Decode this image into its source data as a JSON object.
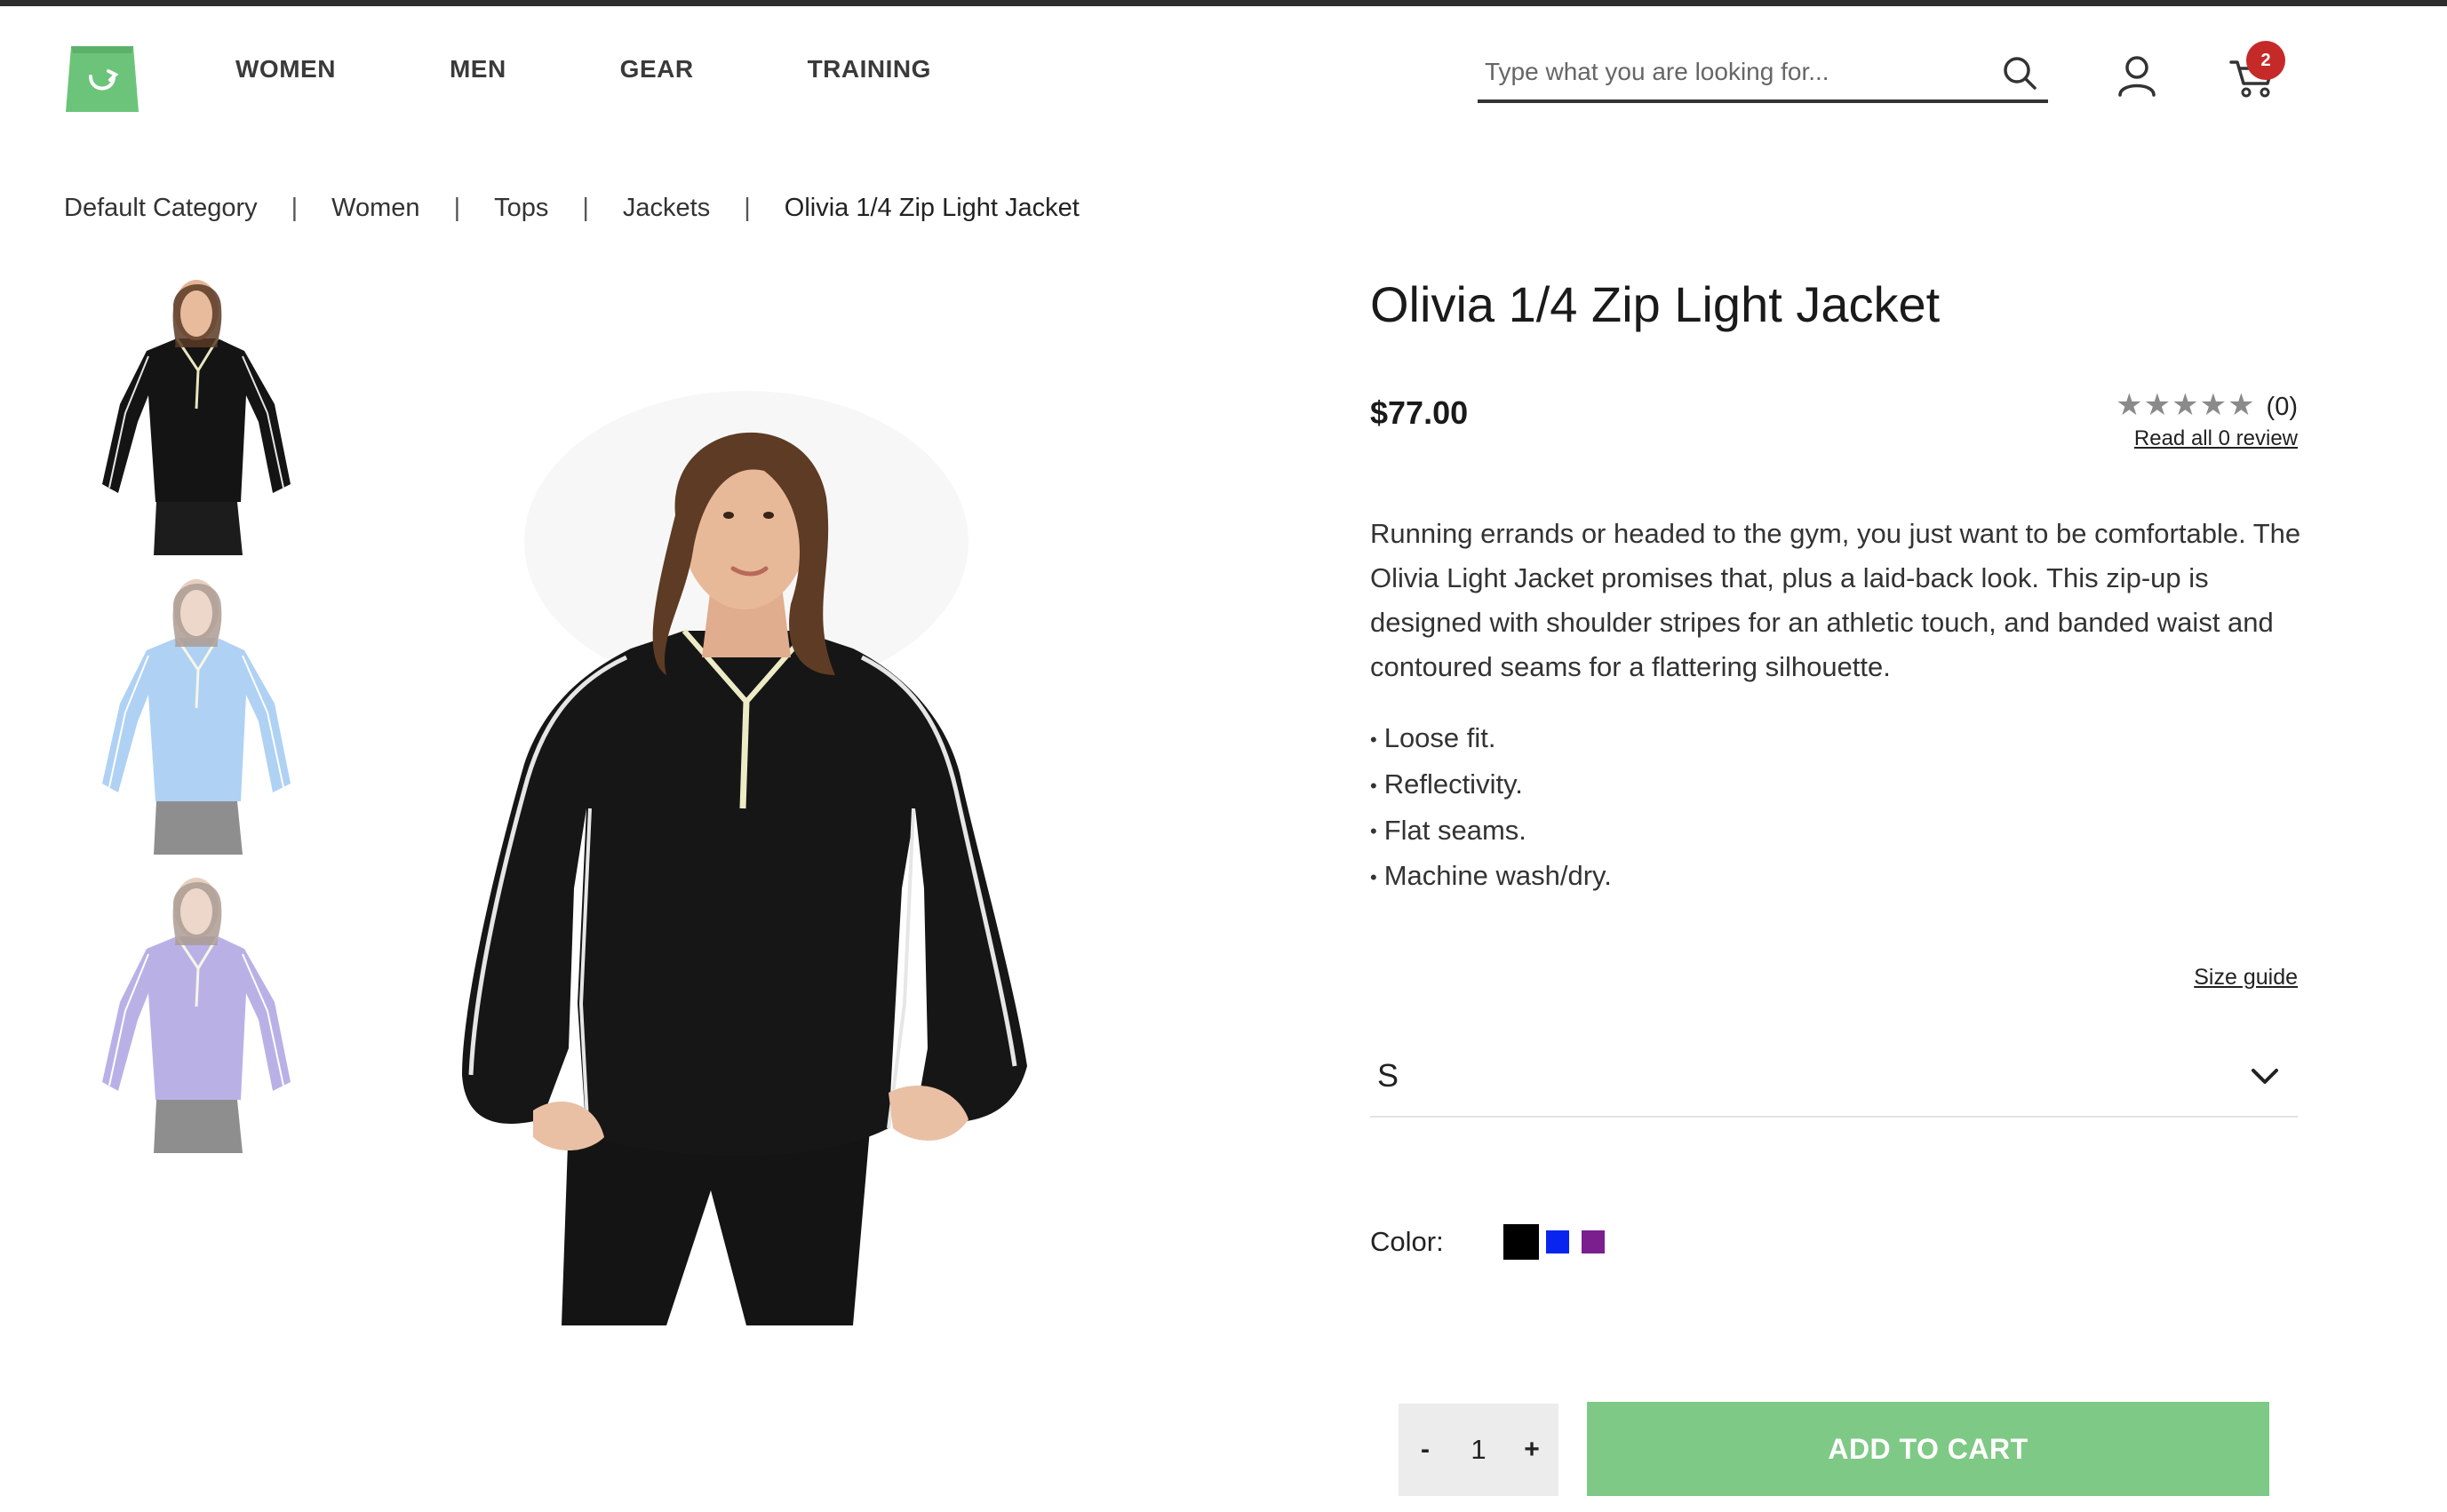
{
  "header": {
    "logo_icon": "shopping-bag-logo",
    "brand_color": "#6cc47a",
    "nav": [
      "WOMEN",
      "MEN",
      "GEAR",
      "TRAINING"
    ],
    "search": {
      "placeholder": "Type what you are looking for...",
      "value": ""
    },
    "icons": [
      "search-icon",
      "account-icon",
      "cart-icon"
    ],
    "cart_count": "2",
    "badge_color": "#c62a28"
  },
  "breadcrumb": [
    "Default Category",
    "Women",
    "Tops",
    "Jackets",
    "Olivia 1/4 Zip Light Jacket"
  ],
  "gallery": {
    "thumbnails": [
      {
        "color_name": "black",
        "hex": "#141414"
      },
      {
        "color_name": "blue",
        "hex": "#9fc8f2"
      },
      {
        "color_name": "purple",
        "hex": "#a59be0"
      }
    ],
    "main_image_color": "#161616"
  },
  "product": {
    "title": "Olivia 1/4 Zip Light Jacket",
    "price": "$77.00",
    "rating": {
      "stars": "★★★★★",
      "count": "(0)",
      "read_link": "Read all 0 review",
      "value": 0
    },
    "description": "Running errands or headed to the gym, you just want to be comfortable. The Olivia Light Jacket promises that, plus a laid-back look. This zip-up is designed with shoulder stripes for an athletic touch, and banded waist and contoured seams for a flattering silhouette.",
    "features": [
      "Loose fit.",
      "Reflectivity.",
      "Flat seams.",
      "Machine wash/dry."
    ],
    "size_guide": "Size guide",
    "size": {
      "selected": "S"
    },
    "color": {
      "label": "Color:",
      "swatches": [
        {
          "name": "black",
          "hex": "#000000",
          "selected": true
        },
        {
          "name": "blue",
          "hex": "#0a24f0"
        },
        {
          "name": "purple",
          "hex": "#7b1f8e"
        }
      ]
    },
    "quantity": {
      "minus": "-",
      "value": "1",
      "plus": "+"
    },
    "add_to_cart": "ADD TO CART",
    "cart_button_color": "#7ec986"
  }
}
